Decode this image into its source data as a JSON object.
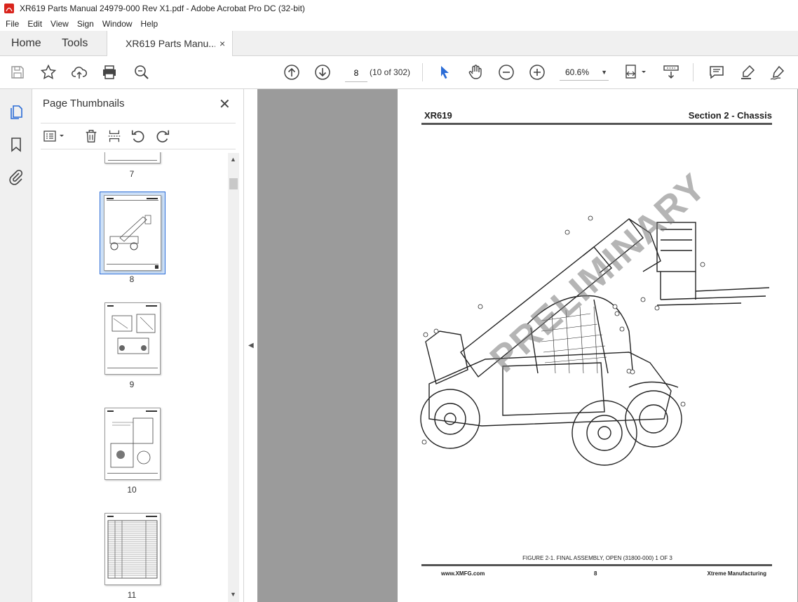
{
  "window": {
    "title": "XR619 Parts Manual 24979-000 Rev X1.pdf - Adobe Acrobat Pro DC (32-bit)"
  },
  "menu": [
    "File",
    "Edit",
    "View",
    "Sign",
    "Window",
    "Help"
  ],
  "tabs": {
    "home": "Home",
    "tools": "Tools",
    "document": "XR619 Parts Manu...",
    "close": "×"
  },
  "toolbar": {
    "page_value": "8",
    "page_count": "(10 of 302)",
    "zoom": "60.6%"
  },
  "panel": {
    "title": "Page Thumbnails",
    "thumbnails": [
      {
        "num": "7"
      },
      {
        "num": "8"
      },
      {
        "num": "9"
      },
      {
        "num": "10"
      },
      {
        "num": "11"
      }
    ]
  },
  "document_page": {
    "header_left": "XR619",
    "header_right": "Section 2 - Chassis",
    "caption": "FIGURE 2-1.  FINAL ASSEMBLY, OPEN  (31800-000)  1 OF 3",
    "footer_left": "www.XMFG.com",
    "footer_center": "8",
    "footer_right": "Xtreme Manufacturing",
    "watermark": "PRELIMINARY"
  },
  "colors": {
    "accent": "#2b6cd6",
    "thumb_selected": "#cde0f7"
  }
}
